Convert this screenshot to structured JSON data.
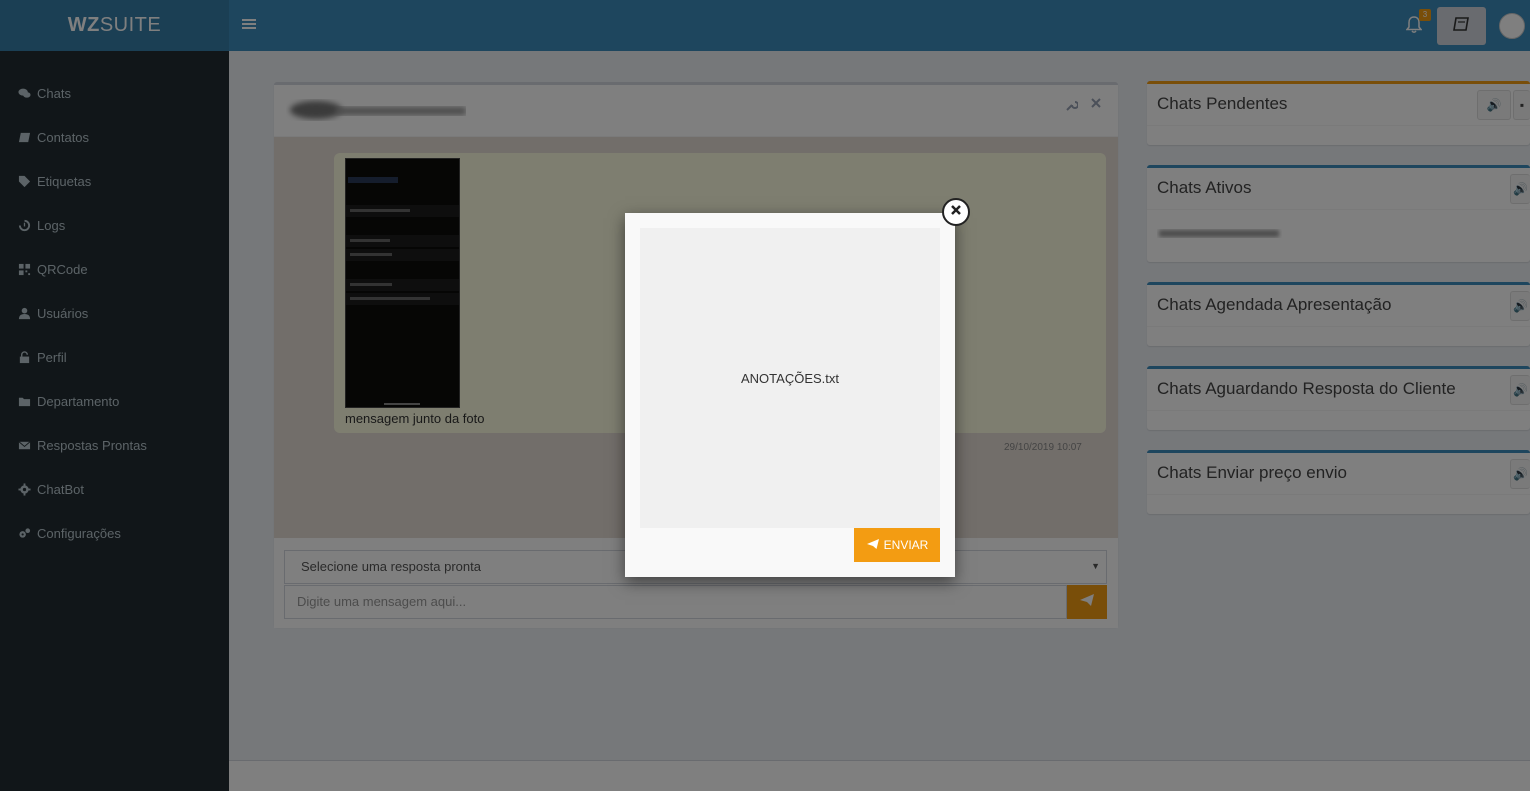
{
  "brand": {
    "bold": "WZ",
    "rest": "SUITE"
  },
  "header": {
    "notification_count": "3"
  },
  "sidebar": {
    "items": [
      {
        "label": "Chats",
        "icon": "comments-icon"
      },
      {
        "label": "Contatos",
        "icon": "book-icon"
      },
      {
        "label": "Etiquetas",
        "icon": "tags-icon"
      },
      {
        "label": "Logs",
        "icon": "history-icon"
      },
      {
        "label": "QRCode",
        "icon": "qrcode-icon"
      },
      {
        "label": "Usuários",
        "icon": "user-icon"
      },
      {
        "label": "Perfil",
        "icon": "lock-icon"
      },
      {
        "label": "Departamento",
        "icon": "folder-icon"
      },
      {
        "label": "Respostas Prontas",
        "icon": "envelope-icon"
      },
      {
        "label": "ChatBot",
        "icon": "cog-icon"
      },
      {
        "label": "Configurações",
        "icon": "cogs-icon"
      }
    ]
  },
  "chat": {
    "message_text": "mensagem junto da foto",
    "message_time": "29/10/2019 10:07",
    "reply_select_placeholder": "Selecione uma resposta pronta",
    "input_placeholder": "Digite uma mensagem aqui..."
  },
  "panels": [
    {
      "title": "Chats Pendentes"
    },
    {
      "title": "Chats Ativos"
    },
    {
      "title": "Chats Agendada Apresentação"
    },
    {
      "title": "Chats Aguardando Resposta do Cliente"
    },
    {
      "title": "Chats Enviar preço envio"
    }
  ],
  "modal": {
    "file_name": "ANOTAÇÕES.txt",
    "send_label": "ENVIAR"
  },
  "colors": {
    "primary": "#3c8dbc",
    "sidebar": "#222d32",
    "accent": "#f39c12"
  }
}
